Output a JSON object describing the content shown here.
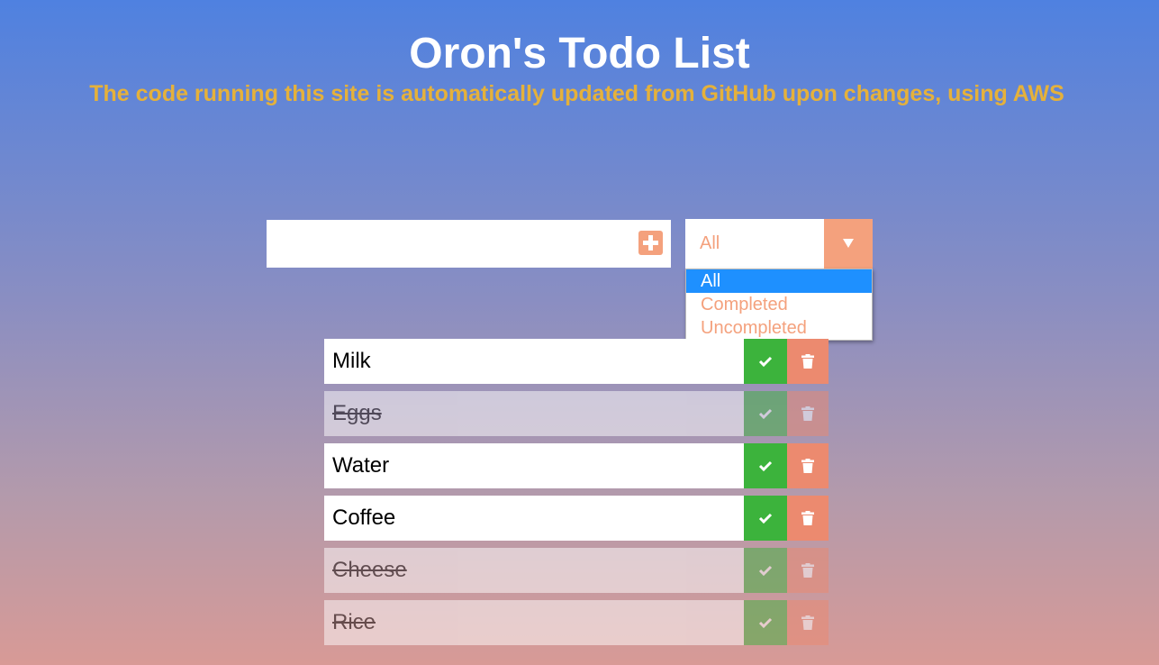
{
  "header": {
    "title": "Oron's Todo List",
    "subtitle": "The code running this site is automatically updated from GitHub upon changes, using AWS"
  },
  "new_todo": {
    "value": "",
    "add_icon": "plus-square-icon"
  },
  "filter": {
    "selected": "All",
    "options": [
      "All",
      "Completed",
      "Uncompleted"
    ],
    "arrow_icon": "triangle-down-icon"
  },
  "todos": [
    {
      "text": "Milk",
      "completed": false
    },
    {
      "text": "Eggs",
      "completed": true
    },
    {
      "text": "Water",
      "completed": false
    },
    {
      "text": "Coffee",
      "completed": false
    },
    {
      "text": "Cheese",
      "completed": true
    },
    {
      "text": "Rice",
      "completed": true
    }
  ],
  "icons": {
    "complete": "check-icon",
    "delete": "trash-icon"
  },
  "colors": {
    "accent": "#f4a17d",
    "title": "#ffffff",
    "subtitle": "#e5b13b",
    "complete_button": "#3cb33c",
    "delete_button": "#ec8a6f",
    "selected_option": "#1e90ff"
  }
}
